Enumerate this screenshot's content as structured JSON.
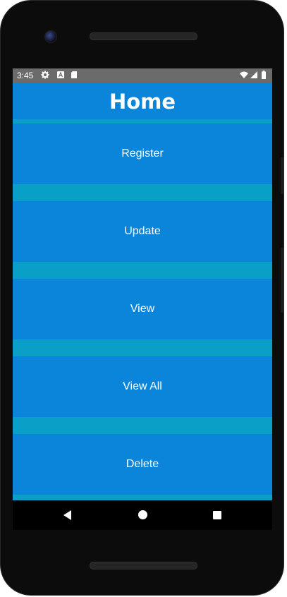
{
  "status_bar": {
    "time": "3:45",
    "left_icons": [
      "gear-icon",
      "font-a-icon",
      "sd-card-icon"
    ],
    "right_icons": [
      "wifi-icon",
      "signal-icon",
      "battery-icon"
    ]
  },
  "app_bar": {
    "title": "Home"
  },
  "menu": {
    "items": [
      {
        "label": "Register"
      },
      {
        "label": "Update"
      },
      {
        "label": "View"
      },
      {
        "label": "View All"
      },
      {
        "label": "Delete"
      }
    ]
  },
  "navigation": {
    "buttons": [
      "back-icon",
      "home-icon",
      "recents-icon"
    ]
  },
  "colors": {
    "app_bar": "#0a85d9",
    "button": "#0a85d9",
    "divider": "#0a9fc7",
    "status_bar": "#6b6b6b"
  }
}
